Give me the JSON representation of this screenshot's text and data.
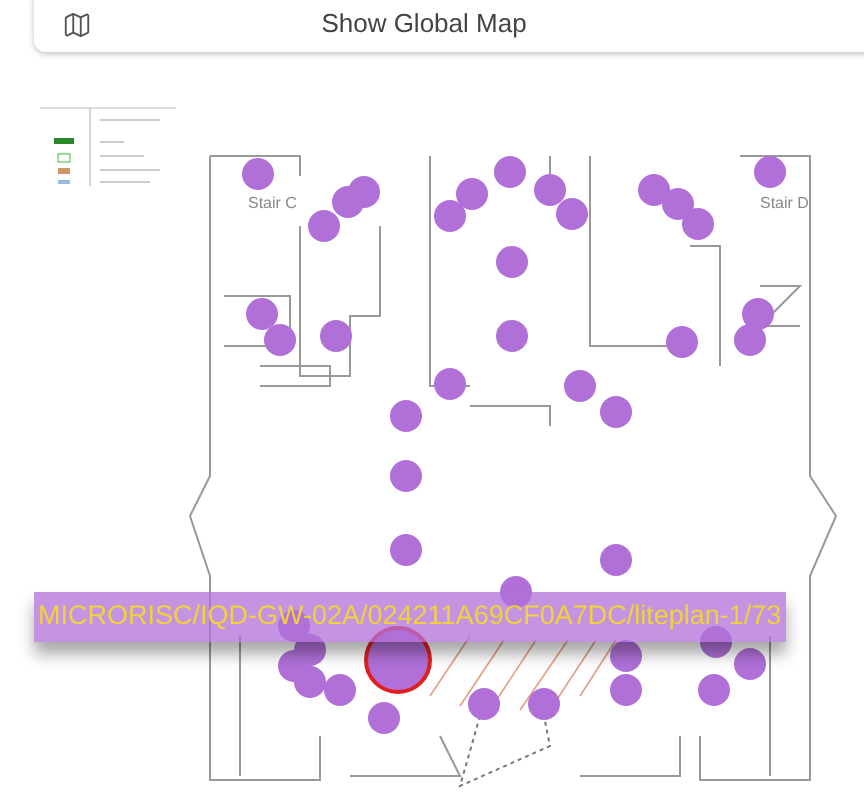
{
  "global_map_button": {
    "label": "Show Global Map"
  },
  "floor_plan": {
    "room_labels": [
      "Stair C",
      "Stair D"
    ],
    "markers": [
      {
        "selected": false
      },
      {
        "selected": false
      },
      {
        "selected": false
      },
      {
        "selected": false
      },
      {
        "selected": false
      },
      {
        "selected": false
      },
      {
        "selected": false
      },
      {
        "selected": false
      },
      {
        "selected": false
      },
      {
        "selected": false
      },
      {
        "selected": false
      },
      {
        "selected": false
      },
      {
        "selected": false
      },
      {
        "selected": false
      },
      {
        "selected": false
      },
      {
        "selected": false
      },
      {
        "selected": false
      },
      {
        "selected": false
      },
      {
        "selected": false
      },
      {
        "selected": false
      },
      {
        "selected": false
      },
      {
        "selected": false
      },
      {
        "selected": false
      },
      {
        "selected": false
      },
      {
        "selected": false
      },
      {
        "selected": false
      },
      {
        "selected": false
      },
      {
        "selected": false
      },
      {
        "selected": false
      },
      {
        "selected": false
      },
      {
        "selected": false
      },
      {
        "selected": false
      },
      {
        "selected": false
      },
      {
        "selected": false
      },
      {
        "selected": false
      },
      {
        "selected": false
      },
      {
        "selected": false
      },
      {
        "selected": false
      },
      {
        "selected": false
      },
      {
        "selected": false
      },
      {
        "selected": false
      },
      {
        "selected": false
      },
      {
        "selected": true
      }
    ],
    "tooltip": "MICRORISC/IQD-GW-02A/024211A69CF0A7DC/liteplan-1/73"
  }
}
